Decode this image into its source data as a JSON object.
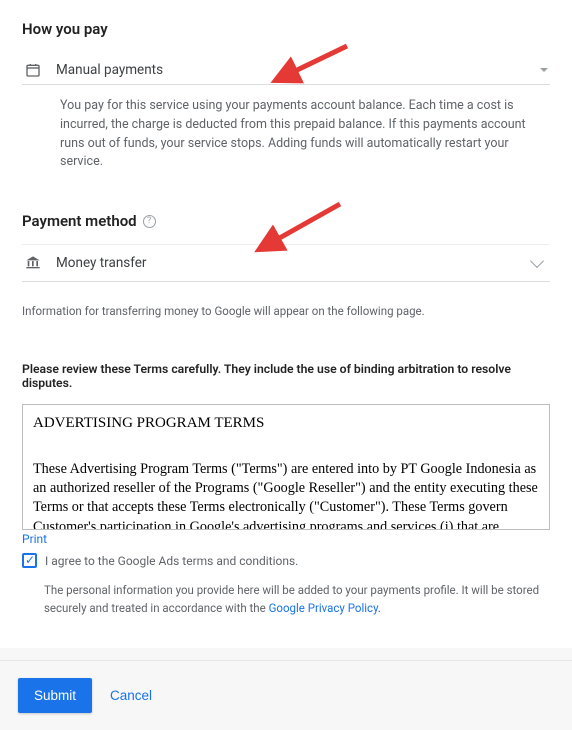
{
  "howYouPay": {
    "title": "How you pay",
    "selected": "Manual payments",
    "description": "You pay for this service using your payments account balance. Each time a cost is incurred, the charge is deducted from this prepaid balance. If this payments account runs out of funds, your service stops. Adding funds will automatically restart your service."
  },
  "paymentMethod": {
    "title": "Payment method",
    "selected": "Money transfer",
    "transferNote": "Information for transferring money to Google will appear on the following page."
  },
  "terms": {
    "reviewNote": "Please review these Terms carefully. They include the use of binding arbitration to resolve disputes.",
    "heading": "ADVERTISING PROGRAM TERMS",
    "body": "These Advertising Program Terms (\"Terms\") are entered into by PT Google Indonesia as an authorized reseller of the Programs (\"Google Reseller\") and the entity executing these Terms or that accepts these Terms electronically (\"Customer\").  These Terms govern Customer's participation in Google's advertising programs and services (i) that are accessible through the",
    "printLabel": "Print",
    "agreeLabel": "I agree to the Google Ads terms and conditions.",
    "agreeChecked": true
  },
  "personalInfo": {
    "textBefore": "The personal information you provide here will be added to your payments profile. It will be stored securely and treated in accordance with the ",
    "linkText": "Google Privacy Policy",
    "textAfter": "."
  },
  "footer": {
    "submit": "Submit",
    "cancel": "Cancel"
  }
}
